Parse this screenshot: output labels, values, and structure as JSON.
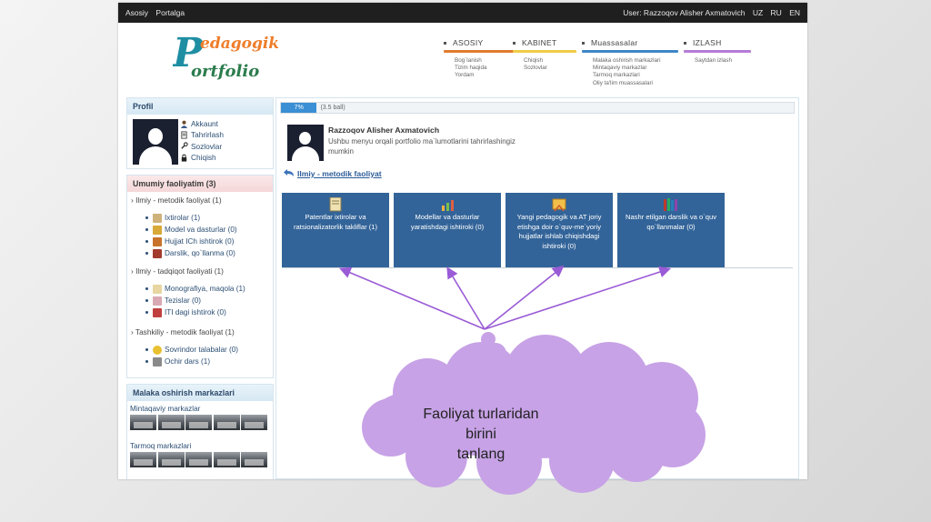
{
  "topbar": {
    "nav": [
      "Asosiy",
      "Portalga"
    ],
    "user": "User: Razzoqov Alisher Axmatovich",
    "languages": [
      "UZ",
      "RU",
      "EN"
    ]
  },
  "logo": {
    "line1": "edagogik",
    "line2": "ortfolio",
    "letter": "P"
  },
  "nav": [
    {
      "label": "ASOSIY",
      "color": "#e07b2e",
      "items": [
        "Bog`lanish",
        "Tizim haqida",
        "Yordam"
      ]
    },
    {
      "label": "KABINET",
      "color": "#f0cd48",
      "items": [
        "Chiqish",
        "Sozlovlar"
      ]
    },
    {
      "label": "Muassasalar",
      "color": "#3f86c6",
      "items": [
        "Malaka oshirish markazlari",
        "Mintaqaviy markazlar",
        "Tarmoq markazlari",
        "Oliy ta'lim muassasalari"
      ]
    },
    {
      "label": "IZLASH",
      "color": "#b57bd6",
      "items": [
        "Saytdan izlash"
      ]
    }
  ],
  "profile": {
    "title": "Profil",
    "links": [
      "Akkaunt",
      "Tahrirlash",
      "Sozlovlar",
      "Chiqish"
    ]
  },
  "activities": {
    "title": "Umumiy faoliyatim (3)",
    "groups": [
      {
        "label": "› Ilmiy - metodik faoliyat (1)",
        "items": [
          "Ixtirolar (1)",
          "Model va dasturlar (0)",
          "Hujjat ICh ishtirok (0)",
          "Darslik, qo`llanma (0)"
        ]
      },
      {
        "label": "› Ilmiy - tadqiqot faoliyati (1)",
        "items": [
          "Monografiya, maqola (1)",
          "Tezislar (0)",
          "ITI dagi ishtirok (0)"
        ]
      },
      {
        "label": "› Tashkiliy - metodik faoliyat (1)",
        "items": [
          "Sovrindor talabalar (0)",
          "Ochir dars (1)"
        ]
      }
    ]
  },
  "centers": {
    "title": "Malaka oshirish markazlari",
    "regional": "Mintaqaviy markazlar",
    "network": "Tarmoq markazlari"
  },
  "main": {
    "progress_percent": 7,
    "progress_label": "7%",
    "progress_points": "(3.5 ball)",
    "user_name": "Razzoqov Alisher Axmatovich",
    "user_desc": "Ushbu menyu orqali portfolio ma`lumotlarini tahrirlashingiz mumkin",
    "section": "Ilmiy - metodik faoliyat",
    "cards": [
      "Patentlar ixtirolar va ratsionalizatorlik takliflar (1)",
      "Modellar va dasturlar yaratishdagi ishtiroki (0)",
      "Yangi pedagogik va AT joriy etishga doir o`quv-me`yoriy hujjatlar ishlab chiqishdagi ishtiroki (0)",
      "Nashr etilgan darslik va o`quv qo`llanmalar (0)"
    ]
  },
  "callout": {
    "line1": "Faoliyat turlaridan birini",
    "line2": "tanlang"
  },
  "colors": {
    "card": "#336499",
    "callout": "#c7a2e6",
    "arrow": "#9a5bd6"
  }
}
